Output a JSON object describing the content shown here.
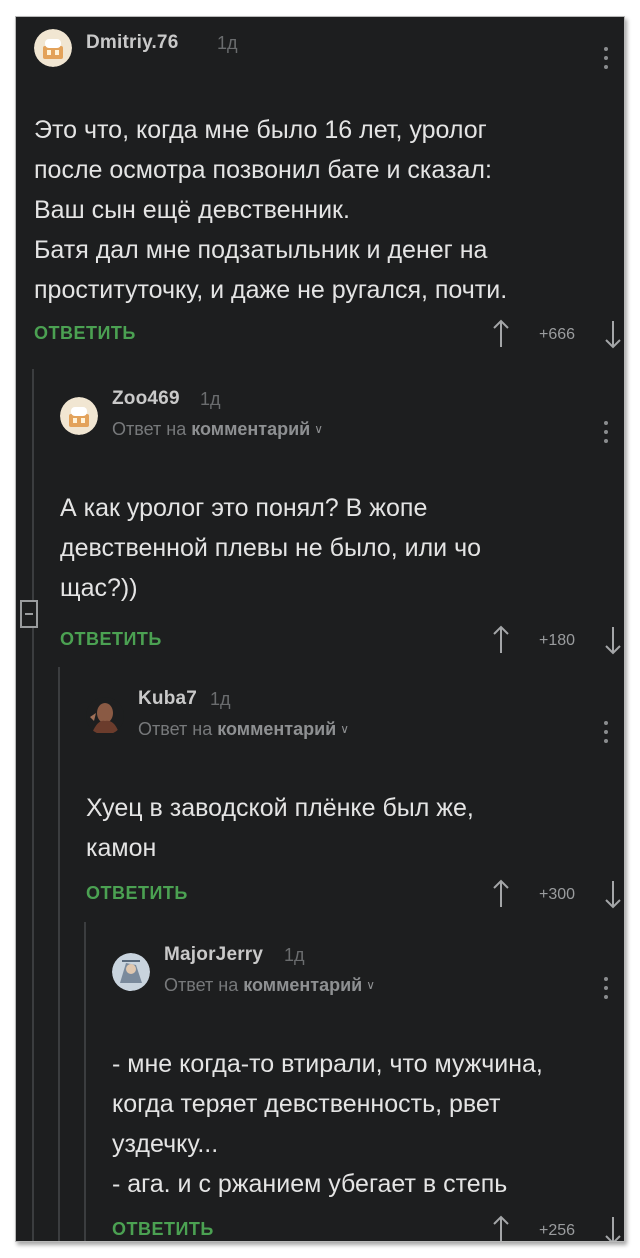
{
  "comments": [
    {
      "username": "Dmitriy.76",
      "time": "1д",
      "reply_to": null,
      "lines": [
        "Это что, когда мне было 16 лет, уролог",
        "после осмотра позвонил бате и сказал:",
        "Ваш сын ещё девственник.",
        "Батя дал мне подзатыльник и денег на",
        "проституточку, и даже не ругался, почти."
      ],
      "reply_label": "ОТВЕТИТЬ",
      "score": "+666"
    },
    {
      "username": "Zoo469",
      "time": "1д",
      "reply_to": {
        "prefix": "Ответ на",
        "link": "комментарий"
      },
      "lines": [
        "А как уролог это понял? В жопе",
        "девственной плевы не было, или чо",
        "щас?))"
      ],
      "reply_label": "ОТВЕТИТЬ",
      "score": "+180"
    },
    {
      "username": "Kuba7",
      "time": "1д",
      "reply_to": {
        "prefix": "Ответ на",
        "link": "комментарий"
      },
      "lines": [
        "Хуец в заводской плёнке был же,",
        "камон"
      ],
      "reply_label": "ОТВЕТИТЬ",
      "score": "+300"
    },
    {
      "username": "MajorJerry",
      "time": "1д",
      "reply_to": {
        "prefix": "Ответ на",
        "link": "комментарий"
      },
      "lines": [
        "- мне когда-то втирали, что мужчина,",
        "когда теряет девственность, рвет",
        "уздечку...",
        "- ага. и с ржанием убегает в степь"
      ],
      "reply_label": "ОТВЕТИТЬ",
      "score": "+256"
    }
  ],
  "colors": {
    "background": "#1d1e1f",
    "text": "#e4e4e4",
    "reply_green": "#4ba152",
    "muted": "#6a6c6e"
  },
  "icons": {
    "avatar_default": "default-avatar-icon",
    "upvote": "arrow-up-icon",
    "downvote": "arrow-down-icon",
    "more": "more-vertical-icon",
    "collapse": "collapse-thread-icon"
  }
}
